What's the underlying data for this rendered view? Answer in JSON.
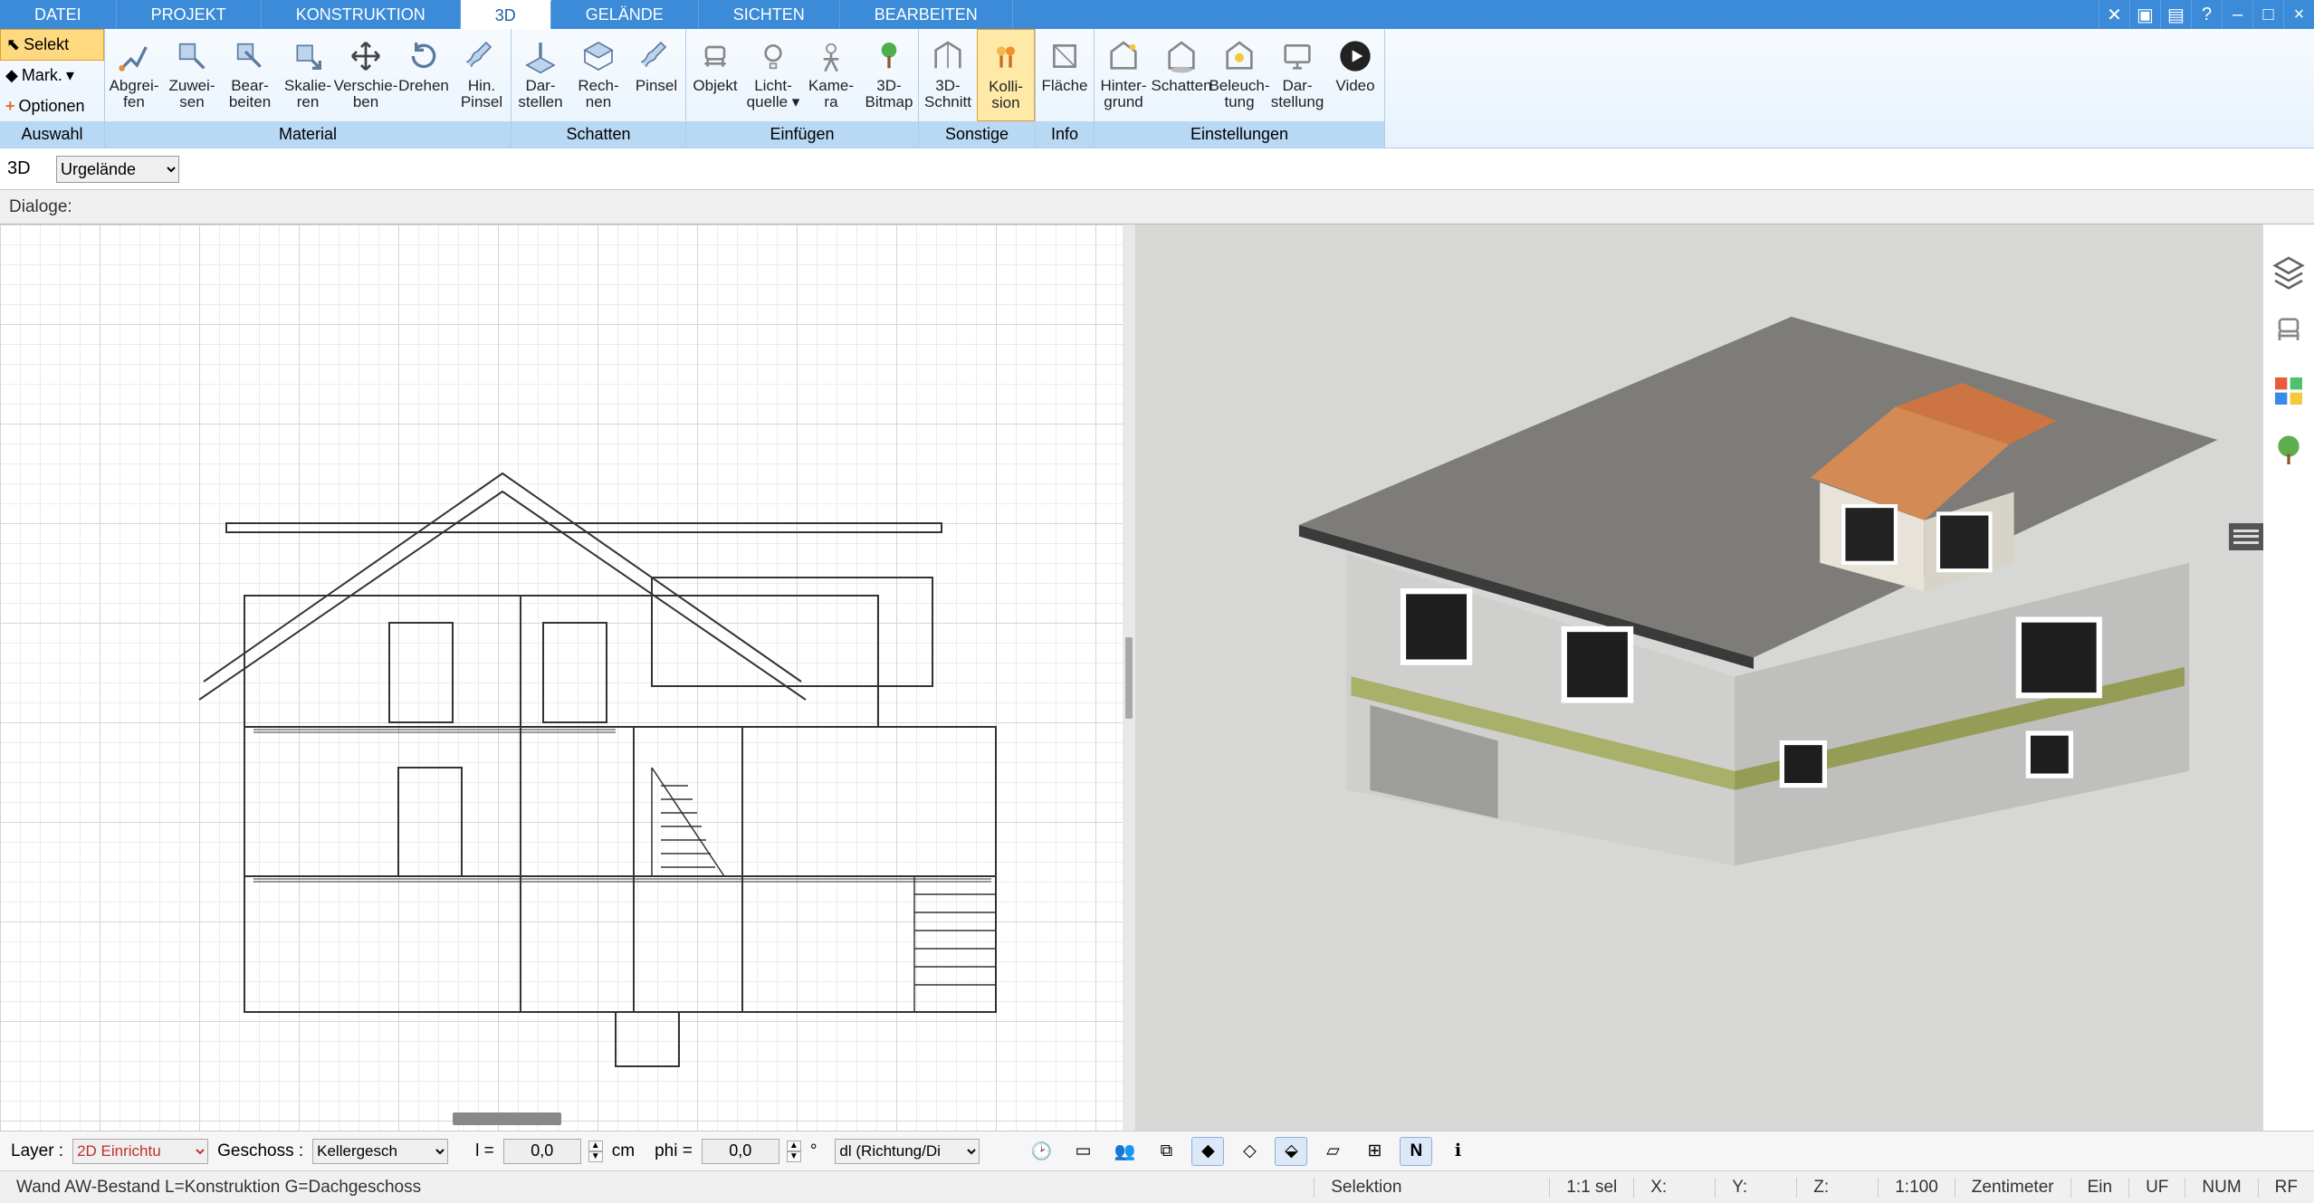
{
  "menu_tabs": [
    "DATEI",
    "PROJEKT",
    "KONSTRUKTION",
    "3D",
    "GELÄNDE",
    "SICHTEN",
    "BEARBEITEN"
  ],
  "active_tab": "3D",
  "ribbon_left": {
    "selekt": "Selekt",
    "mark": "Mark.",
    "optionen": "Optionen",
    "footer": "Auswahl"
  },
  "ribbon_groups": [
    {
      "name": "Material",
      "footer": "Material",
      "items": [
        {
          "key": "abgreifen",
          "label": "Abgrei-\nfen"
        },
        {
          "key": "zuweisen",
          "label": "Zuwei-\nsen"
        },
        {
          "key": "bearbeiten",
          "label": "Bear-\nbeiten"
        },
        {
          "key": "skalieren",
          "label": "Skalie-\nren"
        },
        {
          "key": "verschieben",
          "label": "Verschie-\nben"
        },
        {
          "key": "drehen",
          "label": "Drehen"
        },
        {
          "key": "hinpinsel",
          "label": "Hin.\nPinsel"
        }
      ]
    },
    {
      "name": "Schatten",
      "footer": "Schatten",
      "items": [
        {
          "key": "darstellen",
          "label": "Dar-\nstellen"
        },
        {
          "key": "rechnen",
          "label": "Rech-\nnen"
        },
        {
          "key": "pinsel",
          "label": "Pinsel"
        }
      ]
    },
    {
      "name": "Einfuegen",
      "footer": "Einfügen",
      "items": [
        {
          "key": "objekt",
          "label": "Objekt"
        },
        {
          "key": "lichtquelle",
          "label": "Licht-\nquelle ▾"
        },
        {
          "key": "kamera",
          "label": "Kame-\nra"
        },
        {
          "key": "3dbitmap",
          "label": "3D-\nBitmap"
        }
      ]
    },
    {
      "name": "Sonstige",
      "footer": "Sonstige",
      "items": [
        {
          "key": "3dschnitt",
          "label": "3D-\nSchnitt"
        },
        {
          "key": "kollision",
          "label": "Kolli-\nsion",
          "highlight": true
        }
      ]
    },
    {
      "name": "Info",
      "footer": "Info",
      "items": [
        {
          "key": "flaeche",
          "label": "Fläche"
        }
      ]
    },
    {
      "name": "Einstellungen",
      "footer": "Einstellungen",
      "items": [
        {
          "key": "hintergrund",
          "label": "Hinter-\ngrund"
        },
        {
          "key": "schatten2",
          "label": "Schatten"
        },
        {
          "key": "beleuchtung",
          "label": "Beleuch-\ntung"
        },
        {
          "key": "darstellung",
          "label": "Dar-\nstellung"
        },
        {
          "key": "video",
          "label": "Video"
        }
      ]
    }
  ],
  "viewbar": {
    "mode": "3D",
    "terrain": "Urgelände"
  },
  "dialoge_label": "Dialoge:",
  "side_tools": [
    "layers-icon",
    "chair-icon",
    "palette-icon",
    "tree-icon"
  ],
  "bottom": {
    "layer_label": "Layer :",
    "layer_value": "2D Einrichtu",
    "geschoss_label": "Geschoss :",
    "geschoss_value": "Kellergesch",
    "l_label": "l =",
    "l_value": "0,0",
    "l_unit": "cm",
    "phi_label": "phi =",
    "phi_value": "0,0",
    "phi_unit": "°",
    "mode": "dl (Richtung/Di"
  },
  "status": {
    "left": "Wand AW-Bestand L=Konstruktion G=Dachgeschoss",
    "selektion": "Selektion",
    "sel": "1:1 sel",
    "x": "X:",
    "y": "Y:",
    "z": "Z:",
    "scale": "1:100",
    "unit": "Zentimeter",
    "ein": "Ein",
    "uf": "UF",
    "num": "NUM",
    "rf": "RF"
  }
}
